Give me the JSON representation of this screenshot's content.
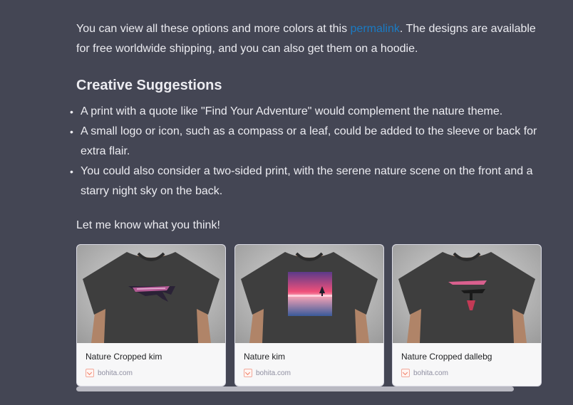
{
  "intro": {
    "text_before": "You can view all these options and more colors at this ",
    "link_text": "permalink",
    "text_after": ". The designs are available for free worldwide shipping, and you can also get them on a hoodie."
  },
  "section": {
    "heading": "Creative Suggestions",
    "bullets": [
      "A print with a quote like \"Find Your Adventure\" would complement the nature theme.",
      "A small logo or icon, such as a compass or a leaf, could be added to the sleeve or back for extra flair.",
      "You could also consider a two-sided print, with the serene nature scene on the front and a starry night sky on the back."
    ]
  },
  "closing": "Let me know what you think!",
  "cards": [
    {
      "title": "Nature Cropped kim",
      "source": "bohita.com"
    },
    {
      "title": "Nature  kim",
      "source": "bohita.com"
    },
    {
      "title": "Nature Cropped dallebg",
      "source": "bohita.com"
    }
  ],
  "colors": {
    "background": "#444654",
    "text": "#ececf1",
    "link": "#1a7bc4",
    "card_bg": "#f7f7f8"
  }
}
